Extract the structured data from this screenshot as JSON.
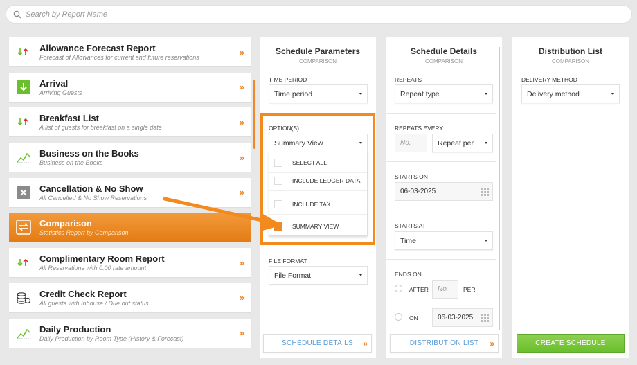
{
  "search": {
    "placeholder": "Search by Report Name"
  },
  "reports": [
    {
      "title": "Allowance Forecast Report",
      "subtitle": "Forecast of Allowances for current and future reservations",
      "icon": "up-down-arrows-icon",
      "chevron": "»"
    },
    {
      "title": "Arrival",
      "subtitle": "Arriving Guests",
      "icon": "arrival-down-icon",
      "chevron": "»"
    },
    {
      "title": "Breakfast List",
      "subtitle": "A list of guests for breakfast on a single date",
      "icon": "up-down-arrows-icon",
      "chevron": "»"
    },
    {
      "title": "Business on the Books",
      "subtitle": "Business on the Books",
      "icon": "trend-line-icon",
      "chevron": "»"
    },
    {
      "title": "Cancellation & No Show",
      "subtitle": "All Cancelled & No Show Reservations",
      "icon": "cancel-x-icon",
      "chevron": "»"
    },
    {
      "title": "Comparison",
      "subtitle": "Statistics Report by Comparison",
      "icon": "compare-arrows-icon",
      "chevron": "",
      "active": true
    },
    {
      "title": "Complimentary Room Report",
      "subtitle": "All Reservations with 0.00 rate amount",
      "icon": "up-down-arrows-icon",
      "chevron": "»"
    },
    {
      "title": "Credit Check Report",
      "subtitle": "All guests with Inhouse / Due out status",
      "icon": "coins-stack-icon",
      "chevron": "»"
    },
    {
      "title": "Daily Production",
      "subtitle": "Daily Production by Room Type (History & Forecast)",
      "icon": "trend-line-icon",
      "chevron": "»"
    }
  ],
  "schedule_parameters": {
    "title": "Schedule Parameters",
    "subtitle": "COMPARISON",
    "time_period_label": "TIME PERIOD",
    "time_period_value": "Time period",
    "options_label": "OPTION(S)",
    "options_value": "Summary View",
    "options": [
      {
        "label": "SELECT ALL",
        "checked": false
      },
      {
        "label": "INCLUDE LEDGER DATA",
        "checked": false
      },
      {
        "label": "INCLUDE TAX",
        "checked": false
      },
      {
        "label": "SUMMARY VIEW",
        "checked": true
      }
    ],
    "file_format_label": "FILE FORMAT",
    "file_format_value": "File Format",
    "button_label": "SCHEDULE DETAILS",
    "button_chevron": "»"
  },
  "schedule_details": {
    "title": "Schedule Details",
    "subtitle": "COMPARISON",
    "repeats_label": "REPEATS",
    "repeats_value": "Repeat type",
    "repeats_every_label": "REPEATS EVERY",
    "repeats_every_placeholder": "No.",
    "repeat_per_value": "Repeat per",
    "starts_on_label": "STARTS ON",
    "starts_on_value": "06-03-2025",
    "starts_at_label": "STARTS AT",
    "starts_at_value": "Time",
    "ends_on_label": "ENDS ON",
    "after_label": "AFTER",
    "after_placeholder": "No.",
    "per_label": "PER",
    "on_label": "ON",
    "on_value": "06-03-2025",
    "button_label": "DISTRIBUTION LIST",
    "button_chevron": "»"
  },
  "distribution_list": {
    "title": "Distribution List",
    "subtitle": "COMPARISON",
    "delivery_method_label": "DELIVERY METHOD",
    "delivery_method_value": "Delivery method",
    "button_label": "CREATE SCHEDULE"
  },
  "colors": {
    "accent": "#f0882b",
    "link": "#5b9bd5",
    "success": "#6bbf2d",
    "highlight": "#f28a1e"
  }
}
